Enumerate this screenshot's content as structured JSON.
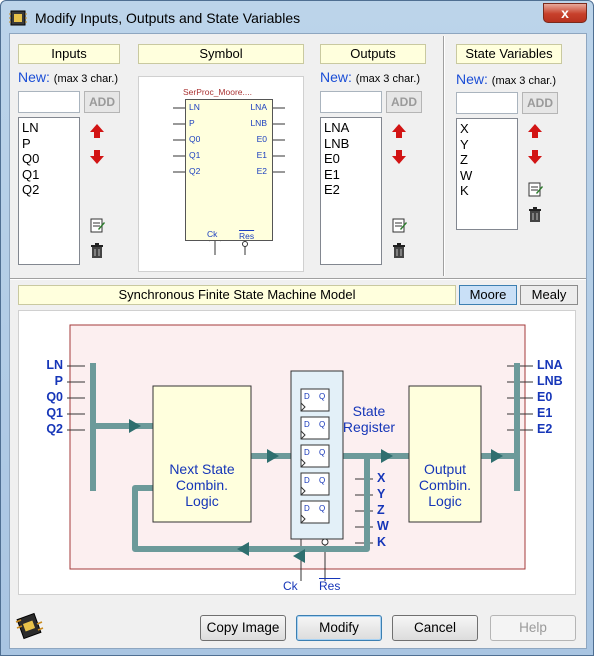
{
  "window": {
    "title": "Modify Inputs, Outputs and State Variables",
    "close_glyph": "x"
  },
  "inputs": {
    "label": "Inputs",
    "new_label": "New:",
    "hint": "(max 3 char.)",
    "add_label": "ADD",
    "items": [
      "LN",
      "P",
      "Q0",
      "Q1",
      "Q2"
    ]
  },
  "symbol": {
    "label": "Symbol",
    "name": "SerProc_Moore....",
    "left_pins": [
      "LN",
      "P",
      "Q0",
      "Q1",
      "Q2"
    ],
    "right_pins": [
      "LNA",
      "LNB",
      "E0",
      "E1",
      "E2"
    ],
    "clock": "Ck",
    "reset": "Res"
  },
  "outputs": {
    "label": "Outputs",
    "new_label": "New:",
    "hint": "(max 3 char.)",
    "add_label": "ADD",
    "items": [
      "LNA",
      "LNB",
      "E0",
      "E1",
      "E2"
    ]
  },
  "state_vars": {
    "label": "State Variables",
    "new_label": "New:",
    "hint": "(max 3 char.)",
    "add_label": "ADD",
    "items": [
      "X",
      "Y",
      "Z",
      "W",
      "K"
    ]
  },
  "model": {
    "label": "Synchronous Finite State Machine Model",
    "moore_label": "Moore",
    "mealy_label": "Mealy",
    "selected": "Moore"
  },
  "diagram": {
    "inputs": [
      "LN",
      "P",
      "Q0",
      "Q1",
      "Q2"
    ],
    "outputs": [
      "LNA",
      "LNB",
      "E0",
      "E1",
      "E2"
    ],
    "state_vars": [
      "X",
      "Y",
      "Z",
      "W",
      "K"
    ],
    "next_state_line1": "Next State",
    "next_state_line2": "Combin.",
    "next_state_line3": "Logic",
    "register_line1": "State",
    "register_line2": "Register",
    "output_line1": "Output",
    "output_line2": "Combin.",
    "output_line3": "Logic",
    "clock": "Ck",
    "reset": "Res",
    "ff_d": "D",
    "ff_q": "Q"
  },
  "buttons": {
    "copy_image": "Copy Image",
    "modify": "Modify",
    "cancel": "Cancel",
    "help": "Help"
  },
  "colors": {
    "bus": "#6c9a9a",
    "label_blue": "#1636b8",
    "block_fill": "#ffffdd",
    "frame": "#a33a3a",
    "up_arrow": "#d21414",
    "down_arrow": "#d21414"
  }
}
